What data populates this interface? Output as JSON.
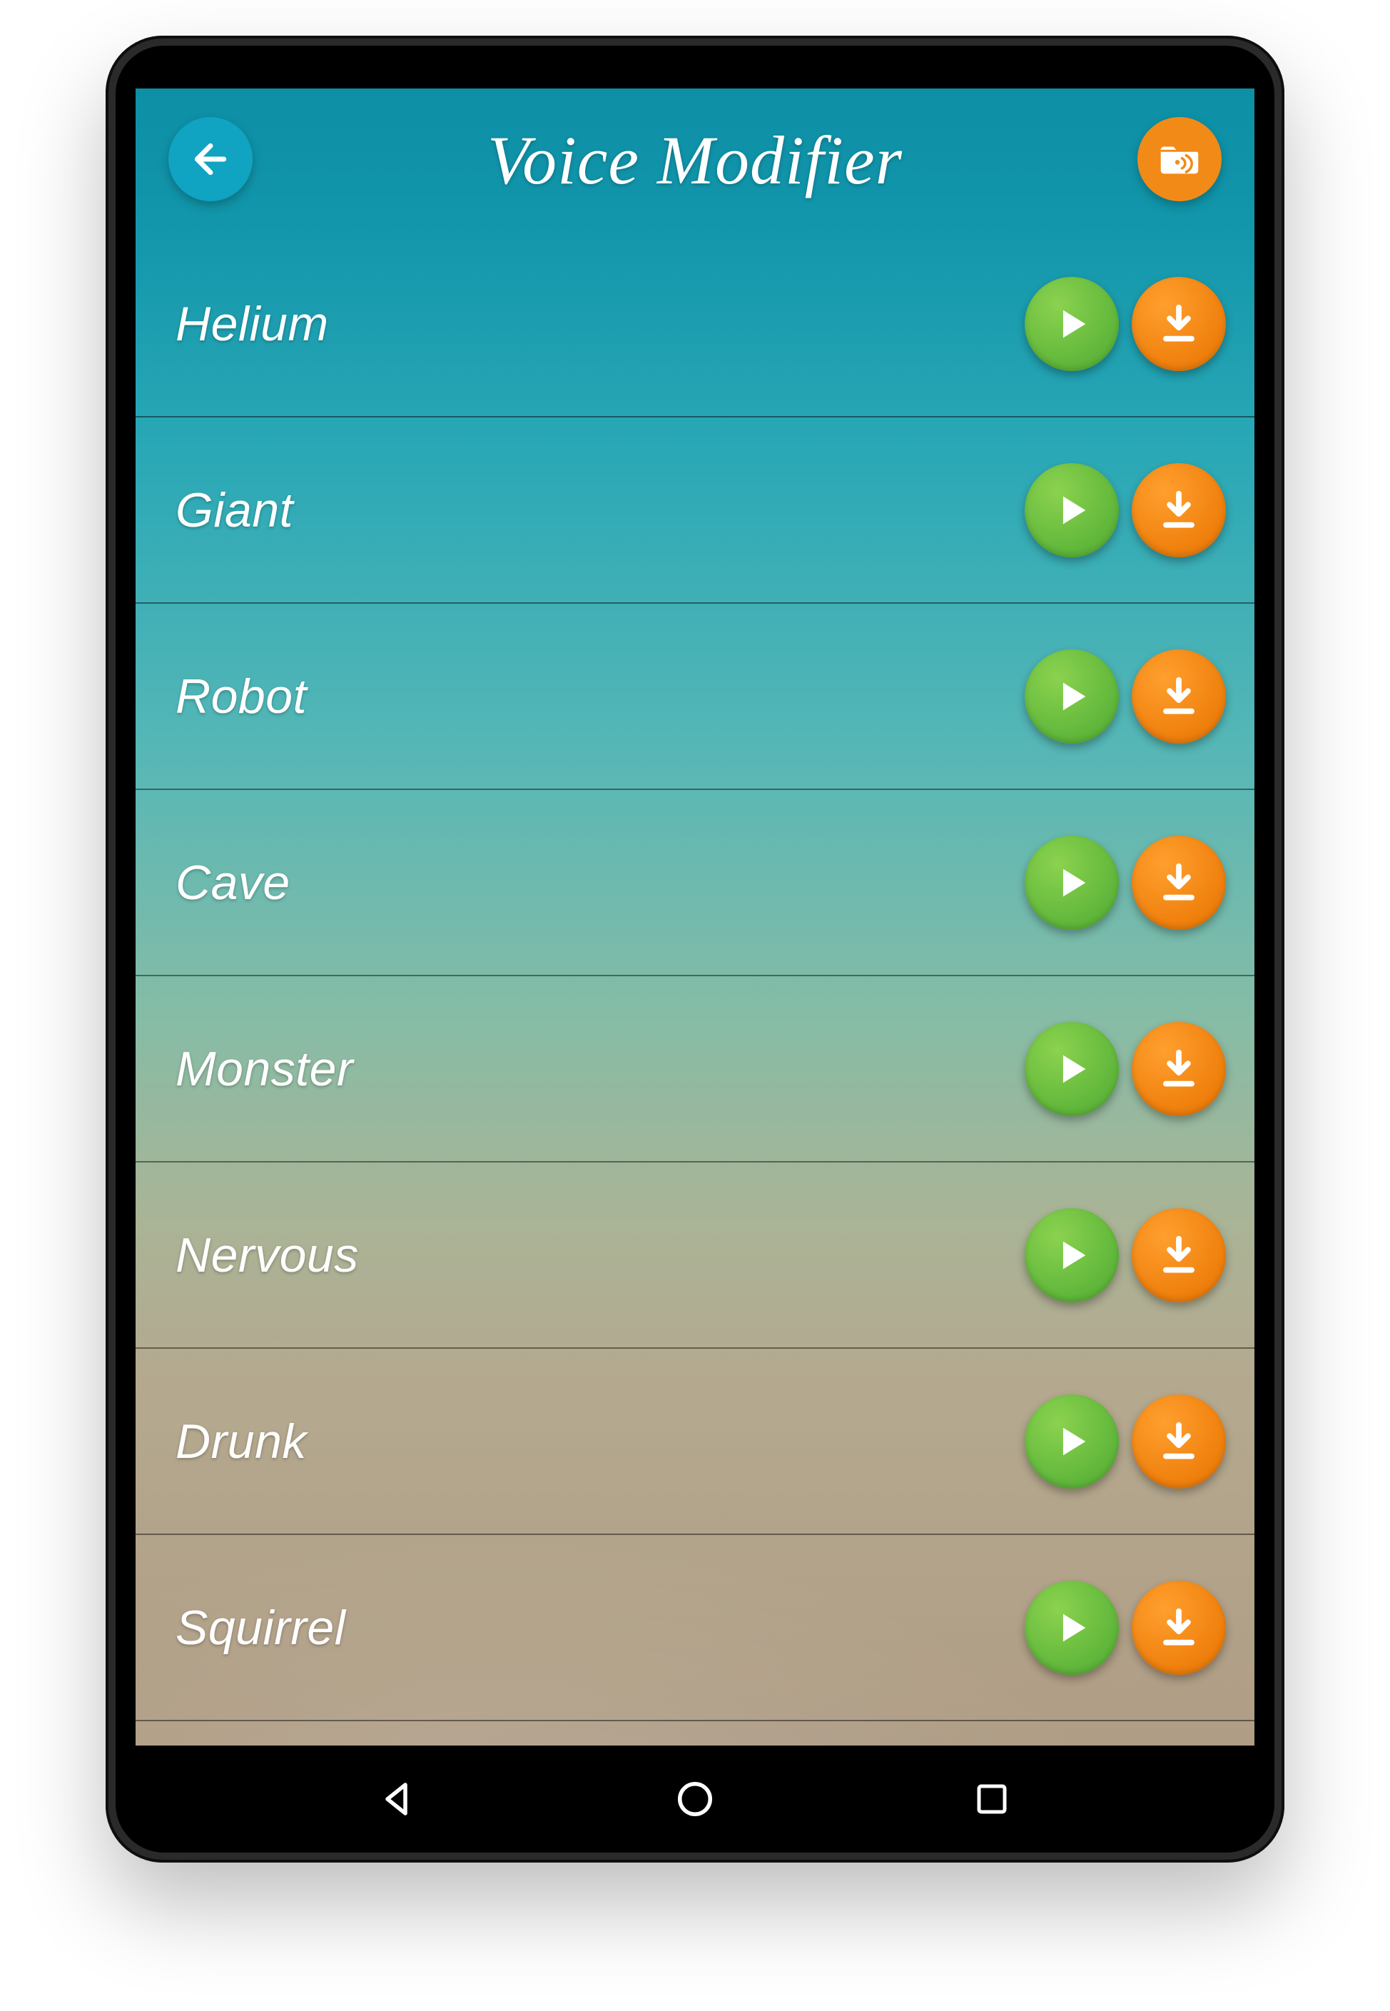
{
  "header": {
    "title": "Voice Modifier",
    "back_icon": "arrow-left",
    "folder_icon": "folder-sound"
  },
  "colors": {
    "play_button": "#6cc04a",
    "download_button": "#f28a17",
    "back_button": "#10a3c2",
    "folder_button": "#f28a17"
  },
  "effects": [
    {
      "label": "Helium"
    },
    {
      "label": "Giant"
    },
    {
      "label": "Robot"
    },
    {
      "label": "Cave"
    },
    {
      "label": "Monster"
    },
    {
      "label": "Nervous"
    },
    {
      "label": "Drunk"
    },
    {
      "label": "Squirrel"
    }
  ],
  "navbar": {
    "back": "triangle-left",
    "home": "circle",
    "recent": "square"
  }
}
